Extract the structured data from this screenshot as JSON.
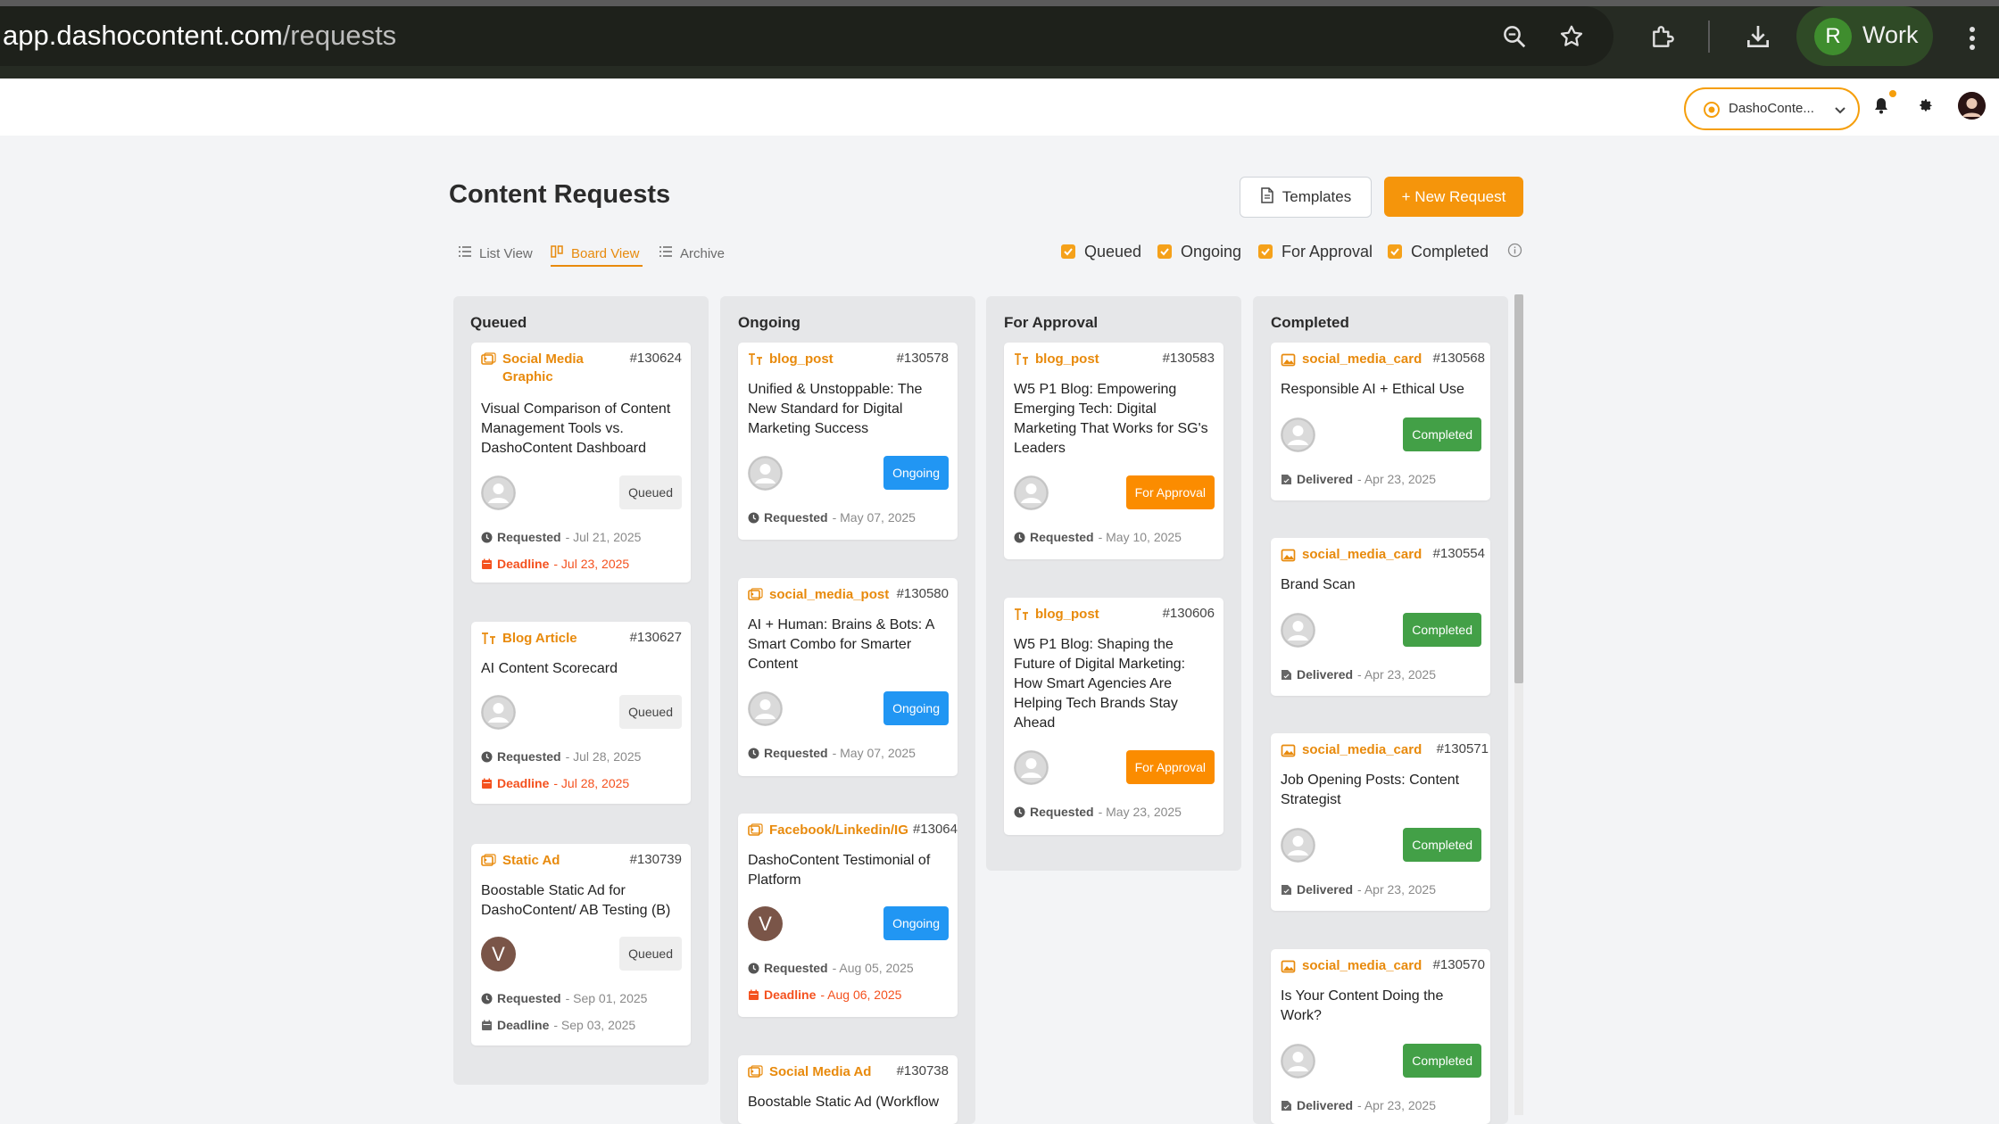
{
  "browser": {
    "url_host": "app.dashocontent.com",
    "url_path": "/requests",
    "profile_initial": "R",
    "profile_name": "Work"
  },
  "topbar": {
    "workspace_name": "DashoConte...",
    "accent": "#f59e0b"
  },
  "header": {
    "title": "Content Requests",
    "templates_label": "Templates",
    "new_request_label": "+ New Request"
  },
  "views": [
    {
      "label": "List View",
      "icon": "list-icon",
      "active": false
    },
    {
      "label": "Board View",
      "icon": "board-icon",
      "active": true
    },
    {
      "label": "Archive",
      "icon": "archive-list-icon",
      "active": false
    }
  ],
  "filters": [
    {
      "label": "Queued",
      "checked": true
    },
    {
      "label": "Ongoing",
      "checked": true
    },
    {
      "label": "For Approval",
      "checked": true
    },
    {
      "label": "Completed",
      "checked": true
    }
  ],
  "columns": [
    {
      "title": "Queued",
      "cards": [
        {
          "type": "Social Media Graphic",
          "type_icon": "image-icon",
          "id": "#130624",
          "title": "Visual Comparison of Content Management Tools vs. DashoContent Dashboard",
          "status": "Queued",
          "requested_label": "Requested",
          "requested": "- Jul 21, 2025",
          "deadline_label": "Deadline",
          "deadline": "- Jul 23, 2025"
        },
        {
          "type": "Blog Article",
          "type_icon": "text-icon",
          "id": "#130627",
          "title": "AI Content Scorecard",
          "status": "Queued",
          "requested_label": "Requested",
          "requested": "- Jul 28, 2025",
          "deadline_label": "Deadline",
          "deadline": "- Jul 28, 2025"
        },
        {
          "type": "Static Ad",
          "type_icon": "image-icon",
          "id": "#130739",
          "title": "Boostable Static Ad for DashoContent/ AB Testing (B)",
          "status": "Queued",
          "avatar_initial": "V",
          "requested_label": "Requested",
          "requested": "- Sep 01, 2025",
          "deadline_label": "Deadline",
          "deadline": "- Sep 03, 2025"
        }
      ]
    },
    {
      "title": "Ongoing",
      "cards": [
        {
          "type": "blog_post",
          "type_icon": "text-icon",
          "id": "#130578",
          "title": "Unified & Unstoppable: The New Standard for Digital Marketing Success",
          "status": "Ongoing",
          "requested_label": "Requested",
          "requested": "- May 07, 2025"
        },
        {
          "type": "social_media_post",
          "type_icon": "image-icon",
          "id": "#130580",
          "title": "AI + Human: Brains & Bots: A Smart Combo for Smarter Content",
          "status": "Ongoing",
          "requested_label": "Requested",
          "requested": "- May 07, 2025"
        },
        {
          "type": "Facebook/Linkedin/IG",
          "type_icon": "image-icon",
          "id": "#13064",
          "title": "DashoContent Testimonial of Platform",
          "status": "Ongoing",
          "avatar_initial": "V",
          "requested_label": "Requested",
          "requested": "- Aug 05, 2025",
          "deadline_label": "Deadline",
          "deadline": "- Aug 06, 2025"
        },
        {
          "type": "Social Media Ad",
          "type_icon": "image-icon",
          "id": "#130738",
          "title": "Boostable Static Ad (Workflow"
        }
      ]
    },
    {
      "title": "For Approval",
      "cards": [
        {
          "type": "blog_post",
          "type_icon": "text-icon",
          "id": "#130583",
          "title": "W5 P1 Blog: Empowering Emerging Tech: Digital Marketing That Works for SG's Leaders",
          "status": "For Approval",
          "requested_label": "Requested",
          "requested": "- May 10, 2025"
        },
        {
          "type": "blog_post",
          "type_icon": "text-icon",
          "id": "#130606",
          "title": "W5 P1 Blog: Shaping the Future of Digital Marketing: How Smart Agencies Are Helping Tech Brands Stay Ahead",
          "status": "For Approval",
          "requested_label": "Requested",
          "requested": "- May 23, 2025"
        }
      ]
    },
    {
      "title": "Completed",
      "cards": [
        {
          "type": "social_media_card",
          "type_icon": "picture-icon",
          "id": "#130568",
          "title": "Responsible AI + Ethical Use",
          "status": "Completed",
          "delivered_label": "Delivered",
          "delivered": "- Apr 23, 2025"
        },
        {
          "type": "social_media_card",
          "type_icon": "picture-icon",
          "id": "#130554",
          "title": "Brand Scan",
          "status": "Completed",
          "delivered_label": "Delivered",
          "delivered": "- Apr 23, 2025"
        },
        {
          "type": "social_media_card",
          "type_icon": "picture-icon",
          "id": "#130571",
          "title": "Job Opening Posts: Content Strategist",
          "status": "Completed",
          "delivered_label": "Delivered",
          "delivered": "- Apr 23, 2025"
        },
        {
          "type": "social_media_card",
          "type_icon": "picture-icon",
          "id": "#130570",
          "title": "Is Your Content Doing the Work?",
          "status": "Completed",
          "delivered_label": "Delivered",
          "delivered": "- Apr 23, 2025"
        }
      ]
    }
  ],
  "status_colors": {
    "Queued": "#eeeeee",
    "Ongoing": "#2196f3",
    "For Approval": "#fb8c00",
    "Completed": "#43a047",
    "deadline": "#f4511e"
  }
}
